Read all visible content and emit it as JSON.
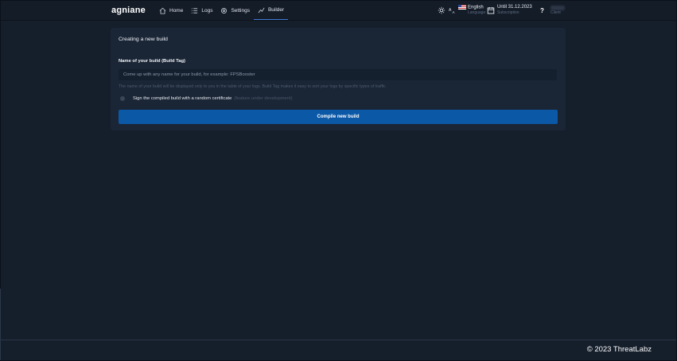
{
  "brand": "agniane",
  "nav": [
    {
      "label": "Home",
      "icon": "home-icon"
    },
    {
      "label": "Logs",
      "icon": "list-icon"
    },
    {
      "label": "Settings",
      "icon": "gear-icon"
    },
    {
      "label": "Builder",
      "icon": "chart-icon",
      "active": true
    }
  ],
  "header": {
    "language_main": "English",
    "language_sub": "Language",
    "subscription_main": "Until 31.12.2023",
    "subscription_sub": "Subscription",
    "help_label": "?",
    "user_sub": "Client"
  },
  "card": {
    "title": "Creating a new build",
    "field_label": "Name of your build (Build Tag)",
    "field_placeholder": "Come up with any name for your build, for example: FPSBooster",
    "field_value": "",
    "hint": "The name of your build will be displayed only to you in the table of your logs. Build Tag makes it easy to sort your logs by specific types of traffic",
    "sign_label": "Sign the compiled build with a random certificate",
    "sign_note": "(feature under development)",
    "compile_label": "Compile new build"
  },
  "footer": {
    "text": "© 2023 ThreatLabz"
  },
  "colors": {
    "accent": "#0b58a6",
    "background": "#151e2b",
    "card": "#1a2535"
  }
}
